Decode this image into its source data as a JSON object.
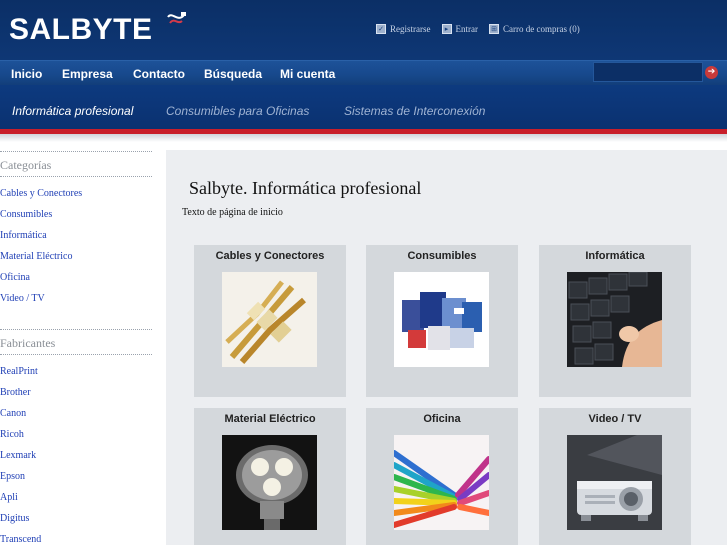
{
  "brand": {
    "logo_text": "SALBYTE"
  },
  "top_links": [
    {
      "label": "Registrarse",
      "icon": "check-icon"
    },
    {
      "label": "Entrar",
      "icon": "login-icon"
    },
    {
      "label": "Carro de compras (0)",
      "icon": "cart-icon"
    }
  ],
  "main_nav": [
    "Inicio",
    "Empresa",
    "Contacto",
    "Búsqueda",
    "Mi cuenta"
  ],
  "search": {
    "value": "",
    "go_icon": "arrow-right-icon"
  },
  "sub_nav": [
    {
      "label": "Informática profesional",
      "active": true
    },
    {
      "label": "Consumibles para Oficinas",
      "active": false
    },
    {
      "label": "Sistemas de Interconexión",
      "active": false
    }
  ],
  "sidebar": {
    "categories_heading": "Categorías",
    "categories": [
      "Cables y Conectores",
      "Consumibles",
      "Informática",
      "Material Eléctrico",
      "Oficina",
      "Video / TV"
    ],
    "manufacturers_heading": "Fabricantes",
    "manufacturers": [
      "RealPrint",
      "Brother",
      "Canon",
      "Ricoh",
      "Lexmark",
      "Epson",
      "Apli",
      "Digitus",
      "Transcend"
    ]
  },
  "main": {
    "title": "Salbyte. Informática profesional",
    "intro": "Texto de página de inicio",
    "cards": [
      {
        "title": "Cables y Conectores",
        "image": "network-cables-photo"
      },
      {
        "title": "Consumibles",
        "image": "ink-cartridges-photo"
      },
      {
        "title": "Informática",
        "image": "keyboard-photo"
      },
      {
        "title": "Material Eléctrico",
        "image": "led-bulb-photo"
      },
      {
        "title": "Oficina",
        "image": "colored-pencils-photo"
      },
      {
        "title": "Video / TV",
        "image": "projector-photo"
      }
    ]
  },
  "colors": {
    "header_bg": "#0b2f66",
    "nav_bg": "#17488b",
    "accent_red": "#c81e2a",
    "link_blue": "#1f3fb5",
    "content_bg": "#eceef1",
    "card_bg": "#d4d8dc"
  }
}
